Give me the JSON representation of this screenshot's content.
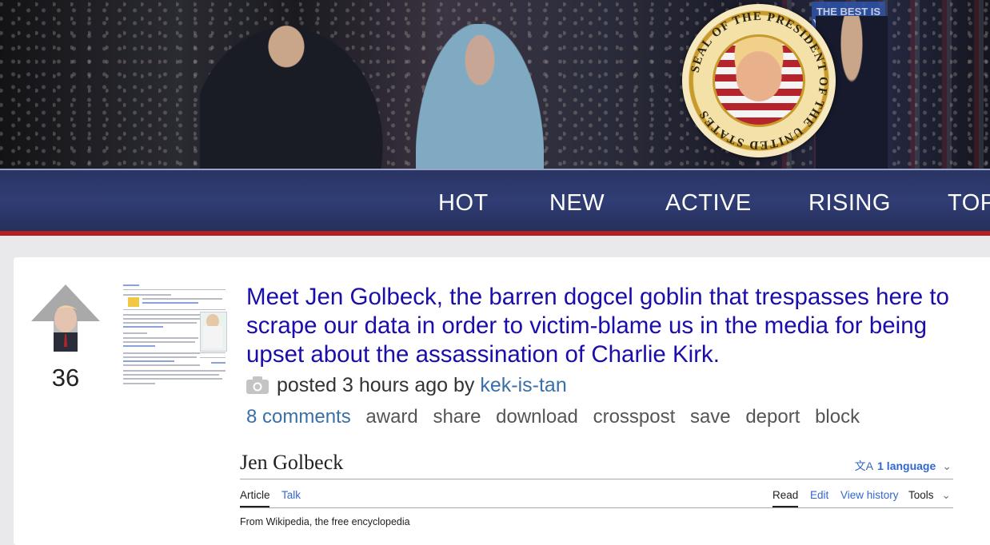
{
  "banner": {
    "sign_text": "THE BEST IS YET TO COME",
    "seal_text": "SEAL OF THE PRESIDENT OF THE UNITED STATES"
  },
  "nav": {
    "items": [
      "HOT",
      "NEW",
      "ACTIVE",
      "RISING",
      "TOP"
    ]
  },
  "post": {
    "score": "36",
    "title": "Meet Jen Golbeck, the barren dogcel goblin that trespasses here to scrape our data in order to victim-blame us in the media for being upset about the assassination of Charlie Kirk.",
    "posted_prefix": "posted 3 hours ago by",
    "author": "kek-is-tan",
    "actions": {
      "comments": "8 comments",
      "award": "award",
      "share": "share",
      "download": "download",
      "crosspost": "crosspost",
      "save": "save",
      "deport": "deport",
      "block": "block"
    },
    "icons": {
      "media": "camera-icon",
      "vote": "upvote-arrow-icon"
    }
  },
  "wiki": {
    "title": "Jen Golbeck",
    "language": "1 language",
    "tabs": {
      "article": "Article",
      "talk": "Talk",
      "read": "Read",
      "edit": "Edit",
      "history": "View history",
      "tools": "Tools"
    },
    "from": "From Wikipedia, the free encyclopedia"
  },
  "colors": {
    "nav_bg": "#303d74",
    "nav_border": "#b31f22",
    "title_link": "#1a0dab",
    "meta_link": "#3a6fa8"
  }
}
